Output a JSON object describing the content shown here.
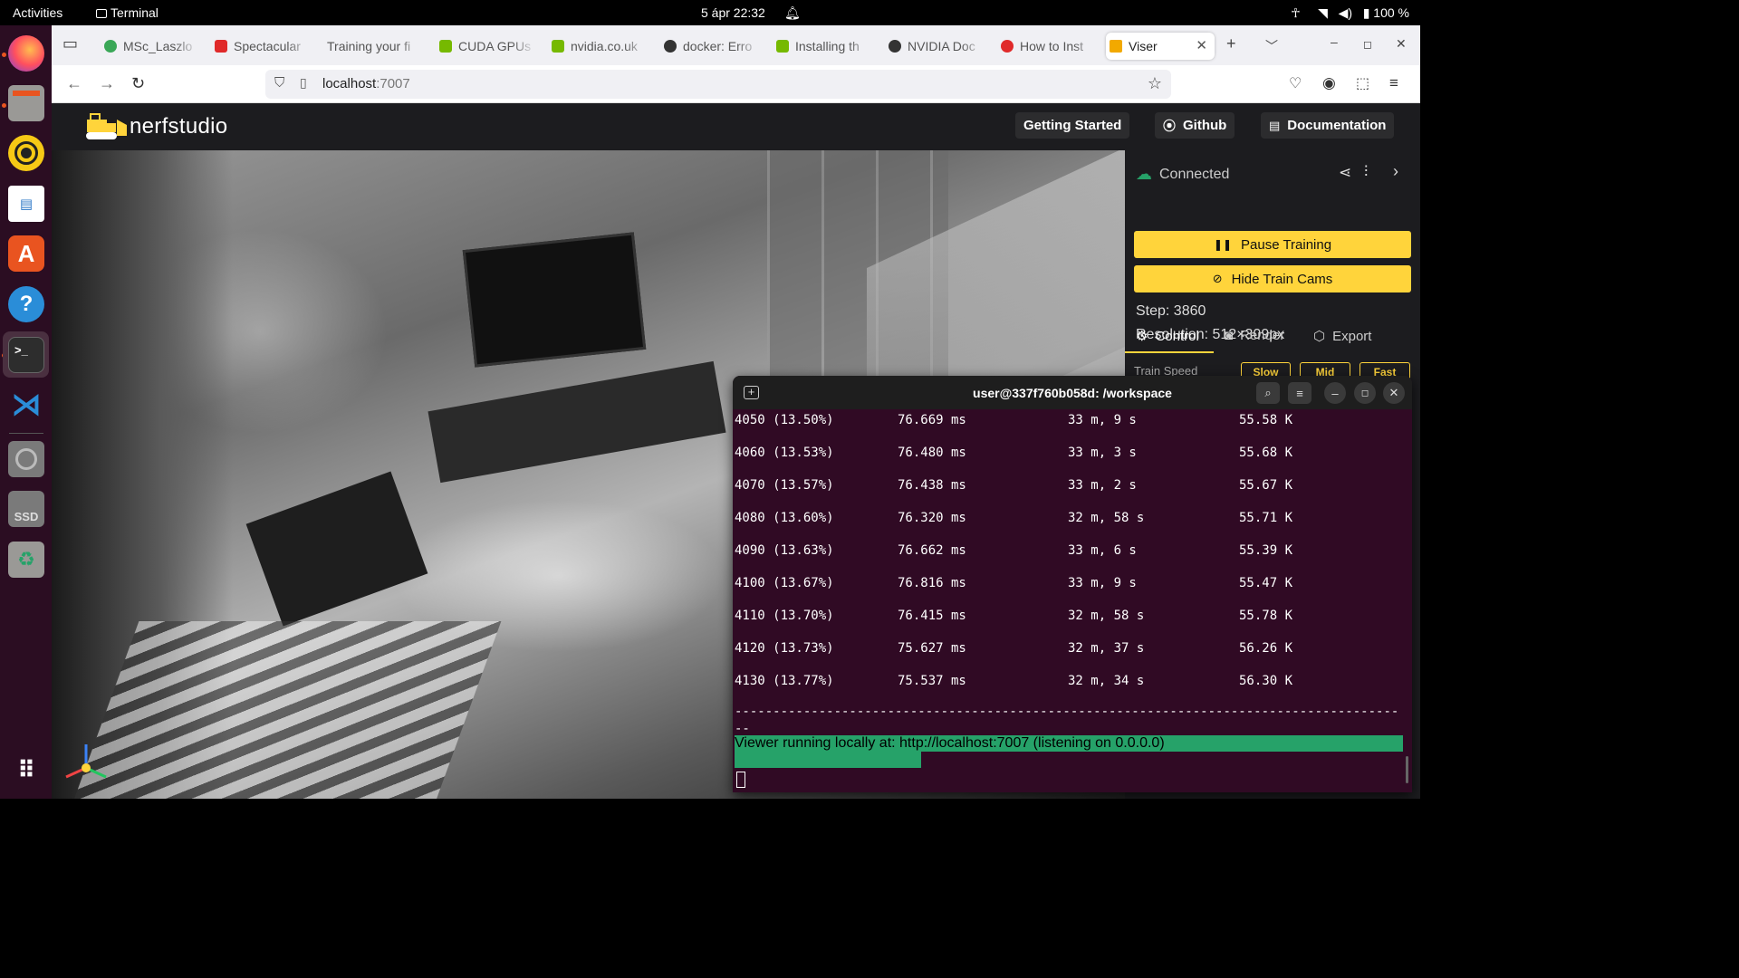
{
  "topbar": {
    "activities": "Activities",
    "app_menu": "Terminal",
    "clock": "5 ápr  22:32",
    "battery": "100 %"
  },
  "dock": {
    "items": [
      "firefox",
      "files",
      "rhythmbox",
      "libreoffice-writer",
      "app-center",
      "help",
      "terminal",
      "vscode",
      "disc-drive",
      "ssd-drive",
      "trash",
      "show-apps"
    ],
    "ssd_label": "SSD"
  },
  "browser": {
    "tabs": [
      {
        "label": "MSc_Laszlo",
        "fav_color": "#3aa757"
      },
      {
        "label": "Spectacular",
        "fav_color": "#e02a2a"
      },
      {
        "label": "Training your fi",
        "fav_color": ""
      },
      {
        "label": "CUDA GPUs",
        "fav_color": "#76b900"
      },
      {
        "label": "nvidia.co.uk",
        "fav_color": "#76b900"
      },
      {
        "label": "docker: Erro",
        "fav_color": "#333333"
      },
      {
        "label": "Installing th",
        "fav_color": "#76b900"
      },
      {
        "label": "NVIDIA Doc",
        "fav_color": "#333333"
      },
      {
        "label": "How to Inst",
        "fav_color": "#e02a2a"
      },
      {
        "label": "Viser",
        "fav_color": "#f2a900"
      }
    ],
    "url_host": "localhost",
    "url_port": ":7007"
  },
  "nerfstudio": {
    "logo_text": "nerfstudio",
    "nav": [
      "Getting Started",
      "Github",
      "Documentation"
    ],
    "status": "Connected",
    "pause_label": "Pause Training",
    "hide_cams_label": "Hide Train Cams",
    "step": "Step: 3860",
    "resolution": "Resolution: 512×309px",
    "tabs": [
      "Control",
      "Render",
      "Export"
    ],
    "train_speed_label": "Train Speed",
    "speeds": [
      "Slow",
      "Mid",
      "Fast"
    ]
  },
  "terminal": {
    "title": "user@337f760b058d: /workspace",
    "rows": [
      {
        "step": "4050 (13.50%)",
        "time": "76.669 ms",
        "eta": "33 m, 9 s",
        "rays": "55.58 K"
      },
      {
        "step": "4060 (13.53%)",
        "time": "76.480 ms",
        "eta": "33 m, 3 s",
        "rays": "55.68 K"
      },
      {
        "step": "4070 (13.57%)",
        "time": "76.438 ms",
        "eta": "33 m, 2 s",
        "rays": "55.67 K"
      },
      {
        "step": "4080 (13.60%)",
        "time": "76.320 ms",
        "eta": "32 m, 58 s",
        "rays": "55.71 K"
      },
      {
        "step": "4090 (13.63%)",
        "time": "76.662 ms",
        "eta": "33 m, 6 s",
        "rays": "55.39 K"
      },
      {
        "step": "4100 (13.67%)",
        "time": "76.816 ms",
        "eta": "33 m, 9 s",
        "rays": "55.47 K"
      },
      {
        "step": "4110 (13.70%)",
        "time": "76.415 ms",
        "eta": "32 m, 58 s",
        "rays": "55.78 K"
      },
      {
        "step": "4120 (13.73%)",
        "time": "75.627 ms",
        "eta": "32 m, 37 s",
        "rays": "56.26 K"
      },
      {
        "step": "4130 (13.77%)",
        "time": "75.537 ms",
        "eta": "32 m, 34 s",
        "rays": "56.30 K"
      }
    ],
    "separator": "-----------------------------------------------------------------------------------------",
    "viewer_msg": "Viewer running locally at: http://localhost:7007 (listening on 0.0.0.0)"
  },
  "colors": {
    "accent": "#ffd43b",
    "terminal_bg": "#300a24",
    "highlight": "#26a269"
  }
}
